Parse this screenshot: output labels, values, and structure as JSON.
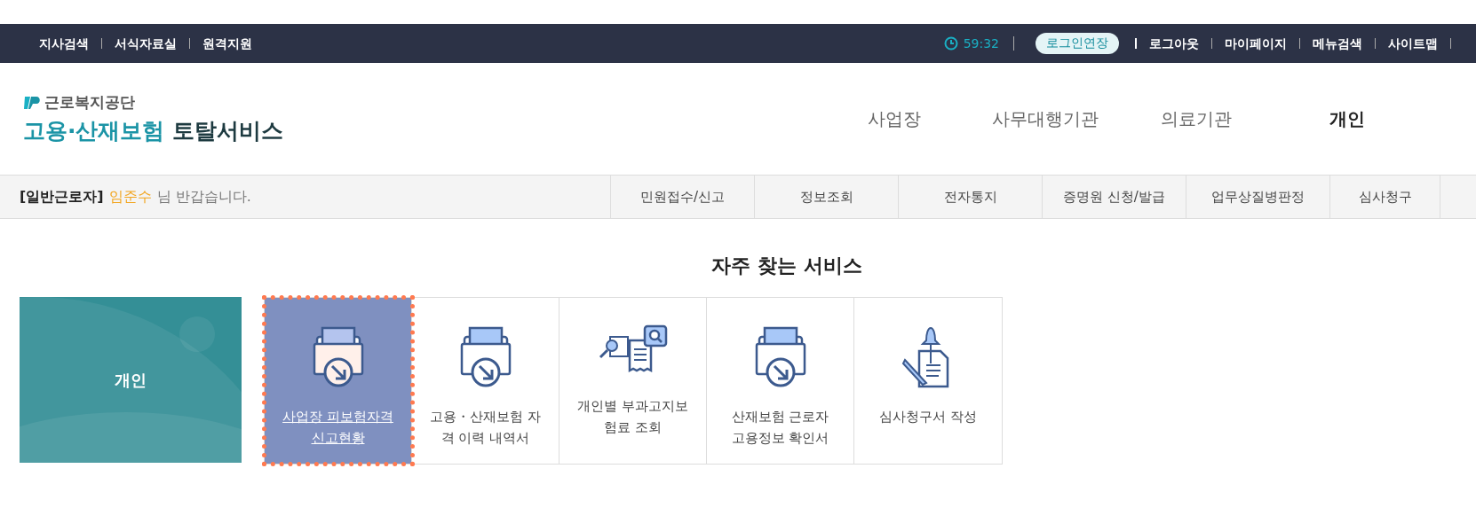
{
  "utility_bar": {
    "left_links": [
      "지사검색",
      "서식자료실",
      "원격지원"
    ],
    "timer": "59:32",
    "extend_button": "로그인연장",
    "right_links": [
      "로그아웃",
      "마이페이지",
      "메뉴검색",
      "사이트맵"
    ]
  },
  "logo": {
    "org": "근로복지공단",
    "service_part1": "고용·산재보험",
    "service_part2": "토탈서비스"
  },
  "main_nav": [
    {
      "label": "사업장",
      "selected": false
    },
    {
      "label": "사무대행기관",
      "selected": false
    },
    {
      "label": "의료기관",
      "selected": false
    },
    {
      "label": "개인",
      "selected": true
    }
  ],
  "greeting": {
    "role": "[일반근로자]",
    "name": "임준수",
    "message": "님 반갑습니다."
  },
  "sub_nav": [
    "민원접수/신고",
    "정보조회",
    "전자통지",
    "증명원 신청/발급",
    "업무상질병판정",
    "심사청구"
  ],
  "section_title": "자주 찾는 서비스",
  "category_card": {
    "label": "개인"
  },
  "services": [
    {
      "kind": "tray",
      "lines": [
        "사업장 피보험자격",
        "신고현황"
      ],
      "selected": true
    },
    {
      "kind": "tray",
      "lines": [
        "고용・산재보험 자",
        "격 이력 내역서"
      ],
      "selected": false
    },
    {
      "kind": "search",
      "lines": [
        "개인별 부과고지보",
        "험료 조회"
      ],
      "selected": false
    },
    {
      "kind": "tray",
      "lines": [
        "산재보험 근로자",
        "고용정보 확인서"
      ],
      "selected": false
    },
    {
      "kind": "pen",
      "lines": [
        "심사청구서 작성"
      ],
      "selected": false
    }
  ]
}
